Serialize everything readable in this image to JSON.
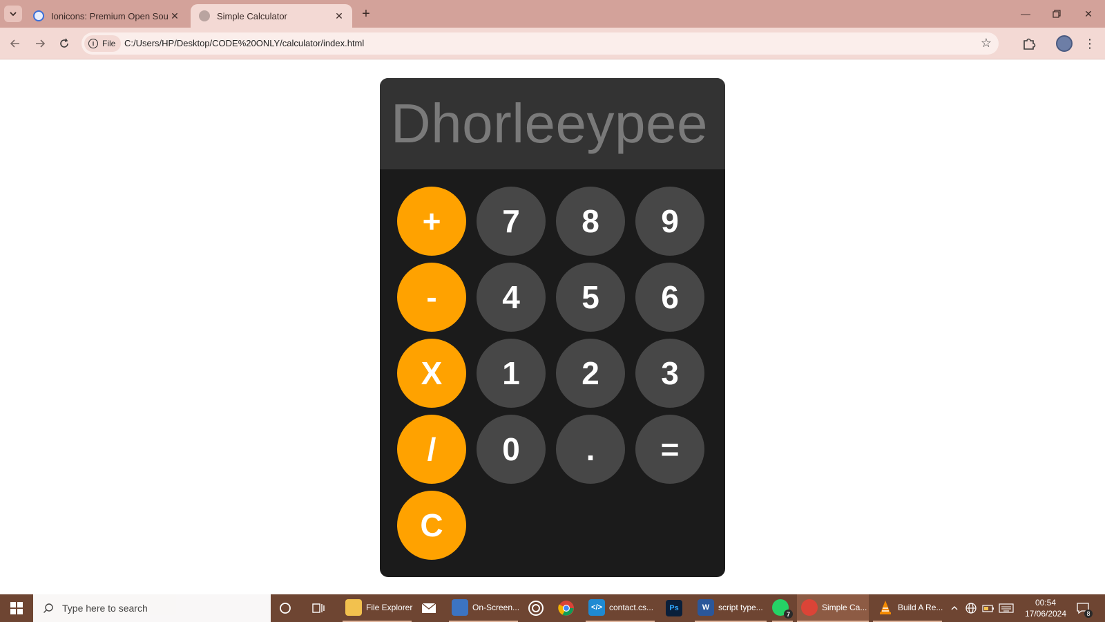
{
  "browser": {
    "tabs": [
      {
        "title": "Ionicons: Premium Open Source Icons",
        "active": false
      },
      {
        "title": "Simple Calculator",
        "active": true
      }
    ],
    "security_chip": "File",
    "url": "C:/Users/HP/Desktop/CODE%20ONLY/calculator/index.html"
  },
  "calculator": {
    "display": "Dhorleeypee",
    "colors": {
      "operator": "#ffa200",
      "number": "#474747",
      "body": "#1b1b1b",
      "display_bg": "#333333"
    },
    "keys": {
      "add": "+",
      "seven": "7",
      "eight": "8",
      "nine": "9",
      "subtract": "-",
      "four": "4",
      "five": "5",
      "six": "6",
      "multiply": "X",
      "one": "1",
      "two": "2",
      "three": "3",
      "divide": "/",
      "zero": "0",
      "decimal": ".",
      "equals": "=",
      "clear": "C"
    }
  },
  "taskbar": {
    "search_placeholder": "Type here to search",
    "apps": [
      {
        "label": "File Explorer",
        "icon": "folder-icon"
      },
      {
        "label": "On-Screen...",
        "icon": "keyboard-icon"
      },
      {
        "label": "contact.cs...",
        "icon": "vscode-icon"
      },
      {
        "label": "script type...",
        "icon": "word-icon"
      },
      {
        "label": "Simple Ca...",
        "icon": "chrome-icon"
      },
      {
        "label": "Build A Re...",
        "icon": "vlc-icon"
      }
    ],
    "whatsapp_badge": "7",
    "notification_badge": "8",
    "time": "00:54",
    "date": "17/06/2024"
  }
}
